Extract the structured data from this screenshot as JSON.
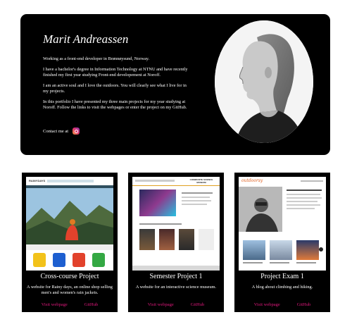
{
  "hero": {
    "name": "Marit Andreassen",
    "paragraphs": [
      "Working as a front-end developer in Brønnøysund, Norway.",
      "I have a bachelor's degree in Information Technology at NTNU and have recently finished my first year studying Front-end developement at Noroff.",
      "I am an active soul and I love the outdoors. You will clearly see what I live for in my projects.",
      "In this portfolio I have presented my three main projects for my year studying at Noroff. Follow the links to visit the webpages or enter the project on my GitHub."
    ],
    "contact_label": "Contact me at",
    "contact_icon": "instagram-icon",
    "accent": "#e0187c"
  },
  "projects": [
    {
      "title": "Cross-course Project",
      "description": "A website for Rainy days, an online shop selling men's and women's rain jackets.",
      "visit_label": "Visit webpage",
      "github_label": "GitHub",
      "shot": {
        "brand": "RAINYDAYS"
      }
    },
    {
      "title": "Semester Project 1",
      "description": "A website for an interactive science museum.",
      "visit_label": "Visit webpage",
      "github_label": "GitHub",
      "shot": {
        "brand": "COMMUNITE SCIENCE MUSEUM"
      }
    },
    {
      "title": "Project Exam 1",
      "description": "A blog about climbing and hiking.",
      "visit_label": "Visit webpage",
      "github_label": "GitHub",
      "shot": {
        "brand": "outdoorsy"
      }
    }
  ]
}
